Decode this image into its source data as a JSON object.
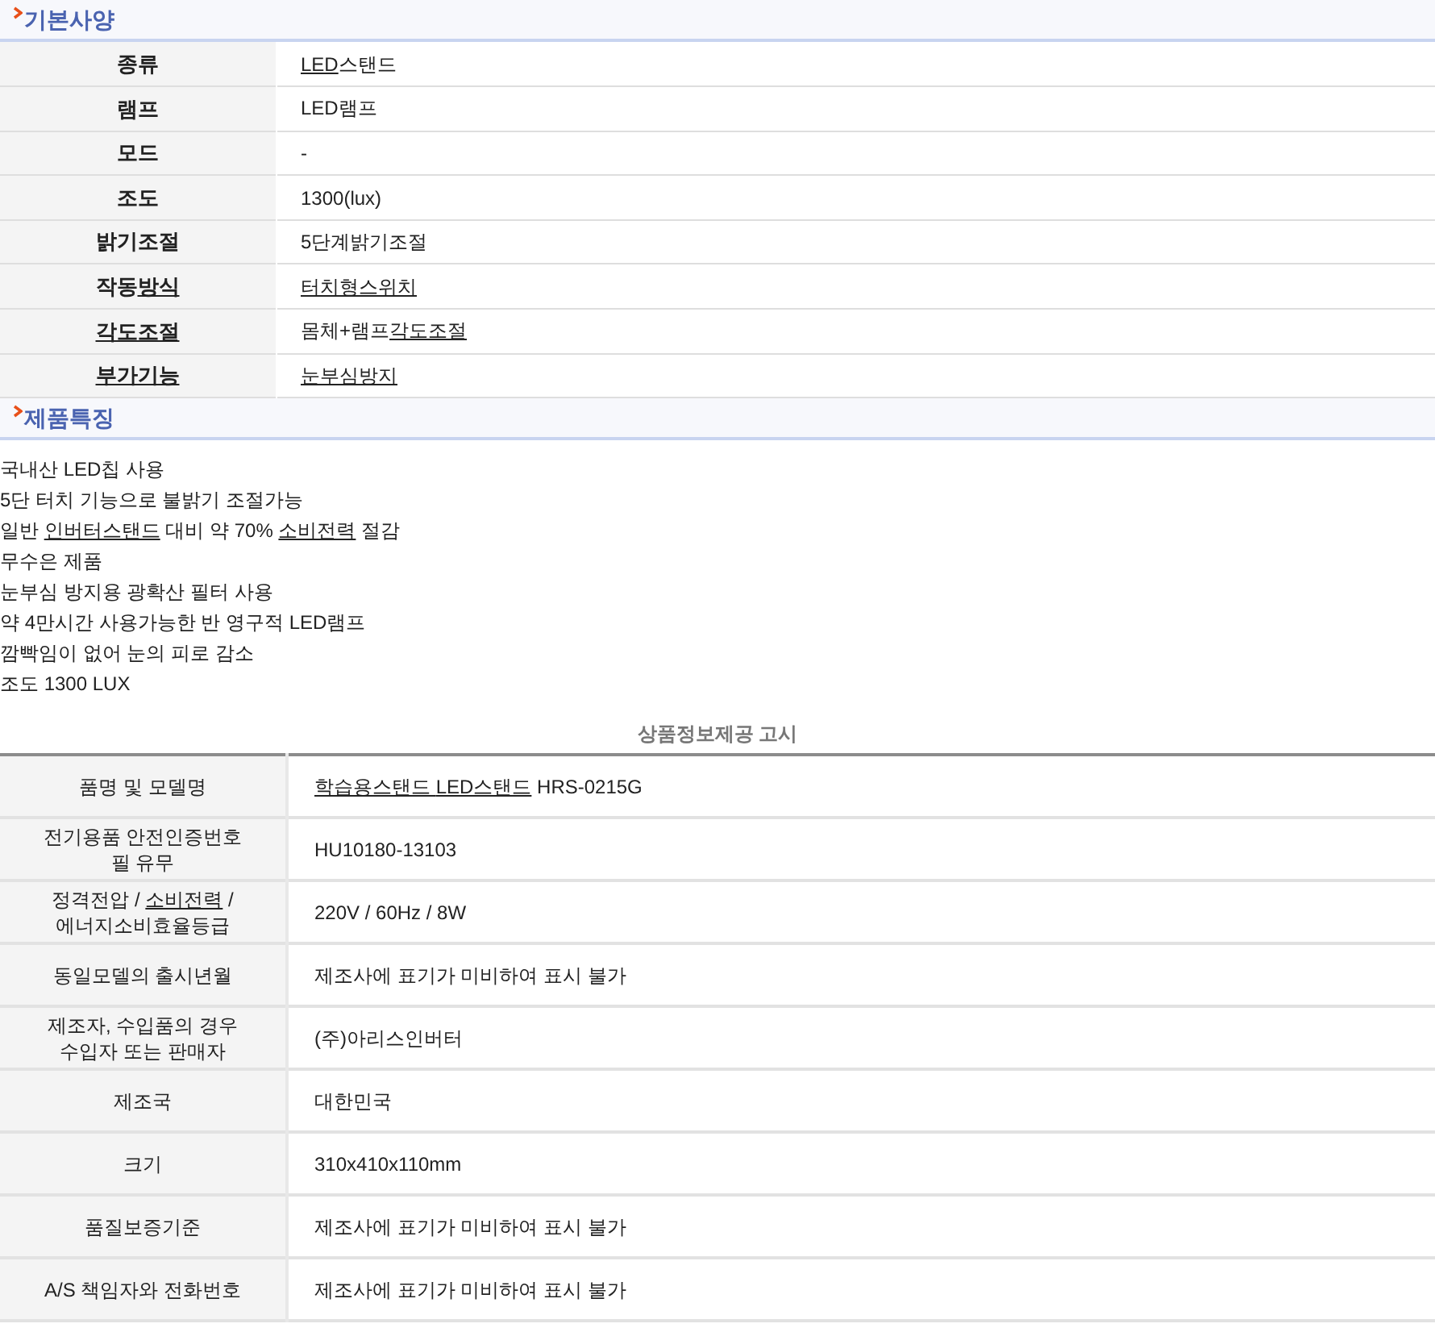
{
  "spec_section": {
    "title": "기본사양",
    "rows": [
      {
        "label": [
          {
            "text": "종류",
            "link": false
          }
        ],
        "value": [
          {
            "text": "LED",
            "link": true
          },
          {
            "text": "스탠드",
            "link": false
          }
        ]
      },
      {
        "label": [
          {
            "text": "램프",
            "link": false
          }
        ],
        "value": [
          {
            "text": "LED램프",
            "link": false
          }
        ]
      },
      {
        "label": [
          {
            "text": "모드",
            "link": false
          }
        ],
        "value": [
          {
            "text": "-",
            "link": false
          }
        ]
      },
      {
        "label": [
          {
            "text": "조도",
            "link": false
          }
        ],
        "value": [
          {
            "text": "1300(lux)",
            "link": false
          }
        ]
      },
      {
        "label": [
          {
            "text": "밝기조절",
            "link": false
          }
        ],
        "value": [
          {
            "text": "5단계밝기조절",
            "link": false
          }
        ]
      },
      {
        "label": [
          {
            "text": "작동",
            "link": false
          },
          {
            "text": "방식",
            "link": true
          }
        ],
        "value": [
          {
            "text": "터치형스위치",
            "link": true
          }
        ]
      },
      {
        "label": [
          {
            "text": "각도조절",
            "link": true
          }
        ],
        "value": [
          {
            "text": "몸체+램프",
            "link": false
          },
          {
            "text": "각도조절",
            "link": true
          }
        ]
      },
      {
        "label": [
          {
            "text": "부가기능",
            "link": true
          }
        ],
        "value": [
          {
            "text": "눈부심방지",
            "link": true
          }
        ]
      }
    ]
  },
  "features_section": {
    "title": "제품특징",
    "lines": [
      [
        {
          "text": "국내산 LED칩 사용",
          "link": false
        }
      ],
      [
        {
          "text": "5단 터치 기능으로 불밝기 조절가능",
          "link": false
        }
      ],
      [
        {
          "text": "일반 ",
          "link": false
        },
        {
          "text": "인버터스탠드",
          "link": true
        },
        {
          "text": " 대비 약 70% ",
          "link": false
        },
        {
          "text": "소비전력",
          "link": true
        },
        {
          "text": " 절감",
          "link": false
        }
      ],
      [
        {
          "text": "무수은 제품",
          "link": false
        }
      ],
      [
        {
          "text": "눈부심 방지용 광확산 필터 사용",
          "link": false
        }
      ],
      [
        {
          "text": "약 4만시간 사용가능한 반 영구적 LED램프",
          "link": false
        }
      ],
      [
        {
          "text": "깜빡임이 없어 눈의 피로 감소",
          "link": false
        }
      ],
      [
        {
          "text": "조도 1300 LUX",
          "link": false
        }
      ]
    ]
  },
  "notice": {
    "title": "상품정보제공 고시",
    "rows": [
      {
        "label": [
          {
            "text": "품명 및 모델명",
            "link": false
          }
        ],
        "value": [
          {
            "text": "학습용스탠드 ",
            "link": true
          },
          {
            "text": "LED스탠드",
            "link": true
          },
          {
            "text": " HRS-0215G",
            "link": false
          }
        ]
      },
      {
        "label": [
          {
            "text": "전기용품 안전인증번호\n필 유무",
            "link": false
          }
        ],
        "value": [
          {
            "text": "HU10180-13103",
            "link": false
          }
        ]
      },
      {
        "label": [
          {
            "text": "정격전압 / ",
            "link": false
          },
          {
            "text": "소비전력",
            "link": true
          },
          {
            "text": " /\n에너지소비효율등급",
            "link": false
          }
        ],
        "value": [
          {
            "text": "220V / 60Hz / 8W",
            "link": false
          }
        ]
      },
      {
        "label": [
          {
            "text": "동일모델의 출시년월",
            "link": false
          }
        ],
        "value": [
          {
            "text": "제조사에 표기가 미비하여 표시 불가",
            "link": false
          }
        ]
      },
      {
        "label": [
          {
            "text": "제조자, 수입품의 경우\n수입자 또는 판매자",
            "link": false
          }
        ],
        "value": [
          {
            "text": "(주)아리스인버터",
            "link": false
          }
        ]
      },
      {
        "label": [
          {
            "text": "제조국",
            "link": false
          }
        ],
        "value": [
          {
            "text": "대한민국",
            "link": false
          }
        ]
      },
      {
        "label": [
          {
            "text": "크기",
            "link": false
          }
        ],
        "value": [
          {
            "text": "310x410x110mm",
            "link": false
          }
        ]
      },
      {
        "label": [
          {
            "text": "품질보증기준",
            "link": false
          }
        ],
        "value": [
          {
            "text": "제조사에 표기가 미비하여 표시 불가",
            "link": false
          }
        ]
      },
      {
        "label": [
          {
            "text": "A/S 책임자와 전화번호",
            "link": false
          }
        ],
        "value": [
          {
            "text": "제조사에 표기가 미비하여 표시 불가",
            "link": false
          }
        ]
      }
    ]
  }
}
